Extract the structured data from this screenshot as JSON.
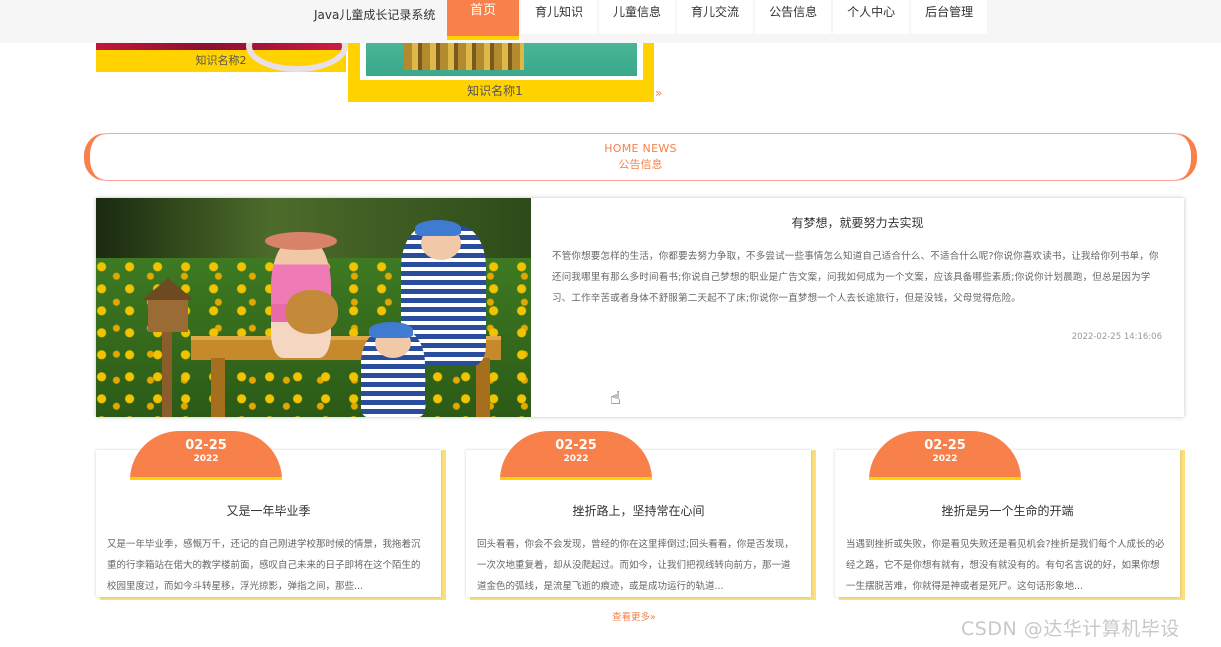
{
  "header": {
    "brand": "Java儿童成长记录系统",
    "nav": [
      {
        "label": "首页",
        "active": true
      },
      {
        "label": "育儿知识"
      },
      {
        "label": "儿童信息"
      },
      {
        "label": "育儿交流"
      },
      {
        "label": "公告信息"
      },
      {
        "label": "个人中心"
      },
      {
        "label": "后台管理"
      }
    ]
  },
  "knowledge": {
    "items": [
      {
        "caption": "知识名称2"
      },
      {
        "caption": "知识名称1"
      }
    ],
    "more_icon": "»"
  },
  "news_section": {
    "title_en": "HOME NEWS",
    "title_cn": "公告信息"
  },
  "featured": {
    "title": "有梦想，就要努力去实现",
    "body": "不管你想要怎样的生活，你都要去努力争取，不多尝试一些事情怎么知道自己适合什么、不适合什么呢?你说你喜欢读书，让我给你列书单，你还问我哪里有那么多时间看书;你说自己梦想的职业是广告文案，问我如何成为一个文案，应该具备哪些素质;你说你计划晨跑，但总是因为学习、工作辛苦或者身体不舒服第二天起不了床;你说你一直梦想一个人去长途旅行，但是没钱，父母觉得危险。",
    "date": "2022-02-25 14:16:06"
  },
  "cards": [
    {
      "month_day": "02-25",
      "year": "2022",
      "title": "又是一年毕业季",
      "body": "又是一年毕业季，感慨万千，还记的自己刚进学校那时候的情景，我拖着沉重的行李箱站在偌大的教学楼前面，感叹自己未来的日子即将在这个陌生的校园里度过，而如今斗转星移，浮光掠影，弹指之间，那些..."
    },
    {
      "month_day": "02-25",
      "year": "2022",
      "title": "挫折路上，坚持常在心间",
      "body": "回头看看，你会不会发现，曾经的你在这里摔倒过;回头看看，你是否发现，一次次地重复着，却从没爬起过。而如今，让我们把视线转向前方，那一道道金色的弧线，是流星飞逝的痕迹，或是成功运行的轨道..."
    },
    {
      "month_day": "02-25",
      "year": "2022",
      "title": "挫折是另一个生命的开端",
      "body": "当遇到挫折或失败，你是看见失败还是看见机会?挫折是我们每个人成长的必经之路，它不是你想有就有，想没有就没有的。有句名言说的好，如果你想一生摆脱苦难，你就得是神或者是死尸。这句话形象地..."
    }
  ],
  "view_more": "查看更多»",
  "watermark": "CSDN @达华计算机毕设",
  "colors": {
    "accent": "#f8804a",
    "yellow": "#ffd200",
    "border_pink": "#f7a7a0"
  }
}
